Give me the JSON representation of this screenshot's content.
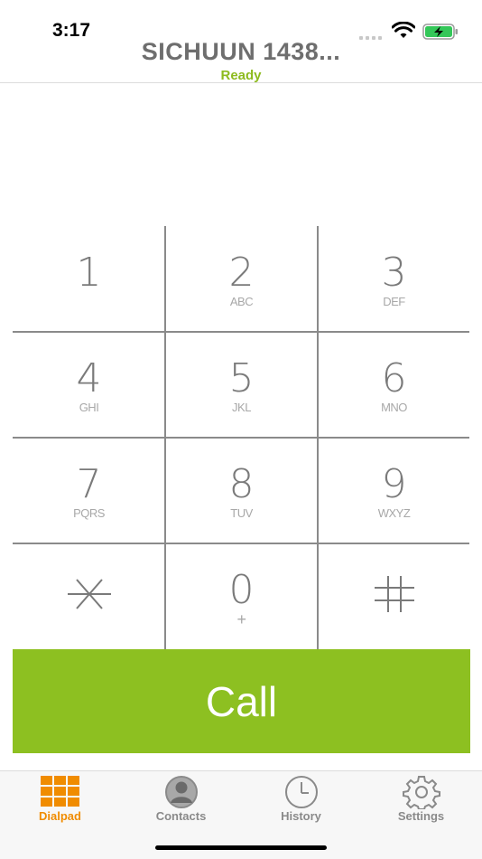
{
  "status_bar": {
    "time": "3:17",
    "wifi_icon": "wifi-icon",
    "battery_icon": "battery-charging-icon"
  },
  "header": {
    "title": "SICHUUN 1438...",
    "status": "Ready",
    "status_color": "#8dbb1e"
  },
  "dialer": {
    "number": ""
  },
  "keypad": {
    "keys": [
      {
        "digit": "1",
        "letters": ""
      },
      {
        "digit": "2",
        "letters": "ABC"
      },
      {
        "digit": "3",
        "letters": "DEF"
      },
      {
        "digit": "4",
        "letters": "GHI"
      },
      {
        "digit": "5",
        "letters": "JKL"
      },
      {
        "digit": "6",
        "letters": "MNO"
      },
      {
        "digit": "7",
        "letters": "PQRS"
      },
      {
        "digit": "8",
        "letters": "TUV"
      },
      {
        "digit": "9",
        "letters": "WXYZ"
      },
      {
        "digit": "*",
        "letters": "",
        "icon": "asterisk-icon"
      },
      {
        "digit": "0",
        "letters": "+"
      },
      {
        "digit": "#",
        "letters": "",
        "icon": "hash-icon"
      }
    ]
  },
  "call": {
    "label": "Call",
    "color": "#8dc021"
  },
  "tabs": [
    {
      "label": "Dialpad",
      "icon": "dialpad-grid-icon",
      "active": true
    },
    {
      "label": "Contacts",
      "icon": "contact-person-icon",
      "active": false
    },
    {
      "label": "History",
      "icon": "clock-icon",
      "active": false
    },
    {
      "label": "Settings",
      "icon": "gear-icon",
      "active": false
    }
  ],
  "colors": {
    "accent": "#f08c00",
    "call_green": "#8dc021"
  }
}
